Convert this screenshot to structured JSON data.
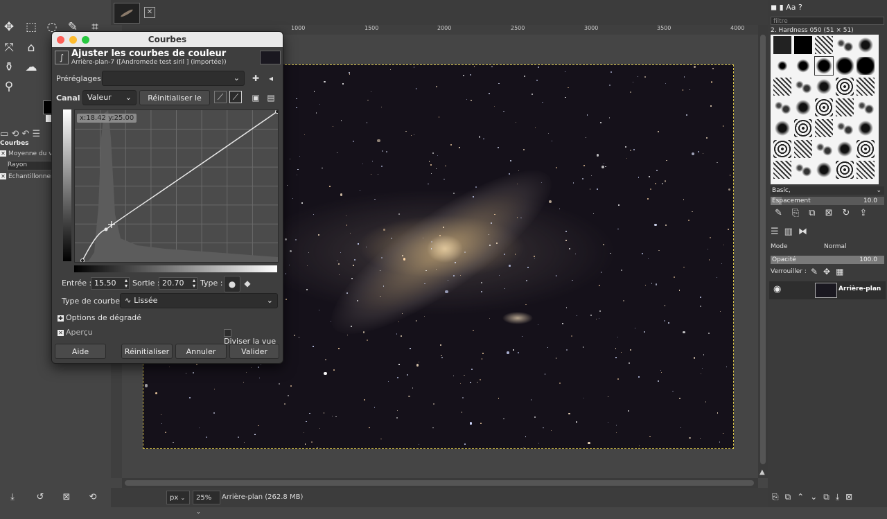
{
  "dialog": {
    "window_title": "Courbes",
    "heading": "Ajuster les courbes de couleur",
    "subheading": "Arrière-plan-7 ([Andromede test siril ] (importée))",
    "presets_label": "Préréglages :",
    "presets_value": "",
    "channel_label": "Canal :",
    "channel_value": "Valeur",
    "reset_channel": "Réinitialiser le canal",
    "coord_tip": "x:18.42 y:25.00",
    "input_label": "Entrée :",
    "input_value": "15.50",
    "output_label": "Sortie :",
    "output_value": "20.70",
    "type_label": "Type :",
    "curve_type_label": "Type de courbe :",
    "curve_type_value": "Lissée",
    "gradient_options": "Options de dégradé",
    "preview": "Aperçu",
    "split_view": "Diviser la vue",
    "btn_help": "Aide",
    "btn_reset": "Réinitialiser",
    "btn_cancel": "Annuler",
    "btn_ok": "Valider"
  },
  "tool_options": {
    "title": "Courbes",
    "opt1": "Moyenne du v",
    "radius": "Rayon",
    "opt2": "Echantillonner"
  },
  "ruler": {
    "labels": [
      "1000",
      "1500",
      "2000",
      "2500",
      "3000",
      "3500",
      "4000"
    ]
  },
  "status": {
    "unit": "px",
    "zoom": "25%",
    "info": "Arrière-plan (262.8 MB)"
  },
  "dock": {
    "filter_placeholder": "filtre",
    "brush_name": "2. Hardness 050 (51 × 51)",
    "brush_set": "Basic,",
    "spacing_label": "Espacement",
    "spacing_value": "10.0",
    "mode_label": "Mode",
    "mode_value": "Normal",
    "opacity_label": "Opacité",
    "opacity_value": "100.0",
    "lock_label": "Verrouiller :",
    "layer_name": "Arrière-plan"
  },
  "colors": {
    "bg": "#454545",
    "dialog_title_bg": "#e9e9e9",
    "selection": "#d8c44a"
  }
}
